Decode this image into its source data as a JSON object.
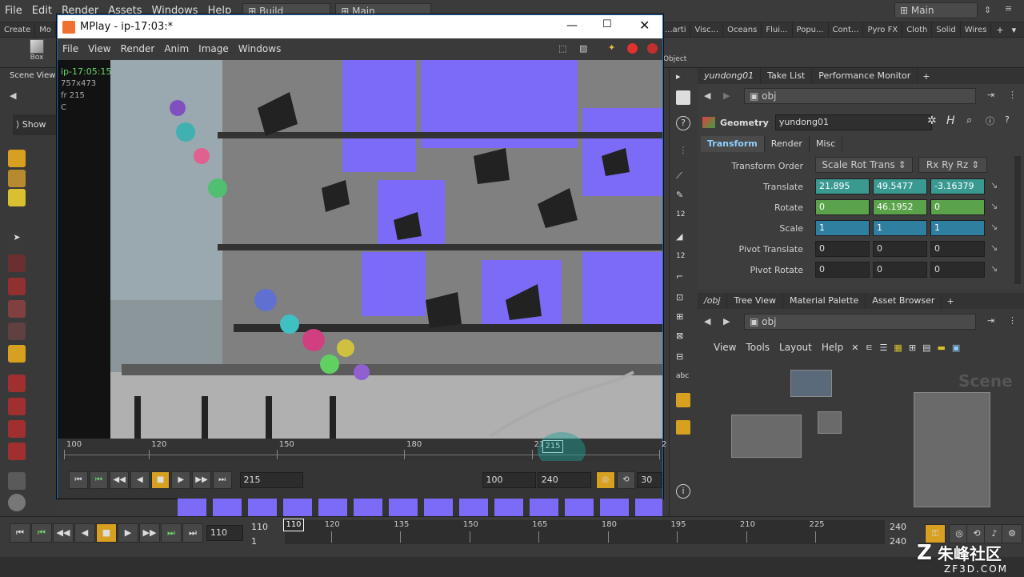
{
  "menubar": {
    "items": [
      "File",
      "Edit",
      "Render",
      "Assets",
      "Windows",
      "Help"
    ],
    "build": "Build",
    "main_tab": "Main",
    "desktop": "Main"
  },
  "shelf": {
    "left_tabs": [
      "Create",
      "Mo"
    ],
    "right_tabs": [
      "...arti",
      "Visc...",
      "Oceans",
      "Flui...",
      "Popu...",
      "Cont...",
      "Pyro FX",
      "Cloth",
      "Solid",
      "Wires"
    ],
    "box_label": "Box",
    "object_label": "Object"
  },
  "scene_view": {
    "label": "Scene View",
    "show": "Show"
  },
  "mplay": {
    "title": "MPlay - ip-17:03:*",
    "menu": [
      "File",
      "View",
      "Render",
      "Anim",
      "Image",
      "Windows"
    ],
    "overlay": {
      "name": "ip-17:05:15",
      "res": "757x473",
      "frame": "fr 215",
      "channel": "C"
    },
    "ticks": [
      "100",
      "120",
      "150",
      "180",
      "210",
      "2"
    ],
    "current_frame_marker": "215",
    "frame_field": "215",
    "start": "100",
    "end": "240",
    "fps": "30"
  },
  "param_panel": {
    "tabs": [
      "yundong01",
      "Take List",
      "Performance Monitor"
    ],
    "path": "obj",
    "node_type": "Geometry",
    "node_name": "yundong01",
    "sub_tabs": [
      "Transform",
      "Render",
      "Misc"
    ],
    "transform_order_label": "Transform Order",
    "transform_order": "Scale Rot Trans",
    "rot_order": "Rx Ry Rz",
    "rows": [
      {
        "label": "Translate",
        "v": [
          "21.895",
          "49.5477",
          "-3.16379"
        ],
        "style": "teal"
      },
      {
        "label": "Rotate",
        "v": [
          "0",
          "46.1952",
          "0"
        ],
        "style": "green"
      },
      {
        "label": "Scale",
        "v": [
          "1",
          "1",
          "1"
        ],
        "style": "blue"
      },
      {
        "label": "Pivot Translate",
        "v": [
          "0",
          "0",
          "0"
        ],
        "style": "plain"
      },
      {
        "label": "Pivot Rotate",
        "v": [
          "0",
          "0",
          "0"
        ],
        "style": "plain"
      }
    ]
  },
  "network": {
    "tabs": [
      "/obj",
      "Tree View",
      "Material Palette",
      "Asset Browser"
    ],
    "path": "obj",
    "menu": [
      "View",
      "Tools",
      "Layout",
      "Help"
    ],
    "scene_watermark": "Scene"
  },
  "timeline": {
    "frame": "110",
    "start": "110",
    "end_top": "240",
    "end_bottom": "240",
    "one": "1",
    "marker": "110",
    "ticks": [
      "120",
      "135",
      "150",
      "165",
      "180",
      "195",
      "210",
      "225"
    ]
  },
  "watermark": {
    "brand": "朱峰社区",
    "url": "ZF3D.COM"
  },
  "colors": {
    "accent": "#f0a030",
    "purple": "#7b6bf6",
    "green_text": "#6dd36d"
  }
}
